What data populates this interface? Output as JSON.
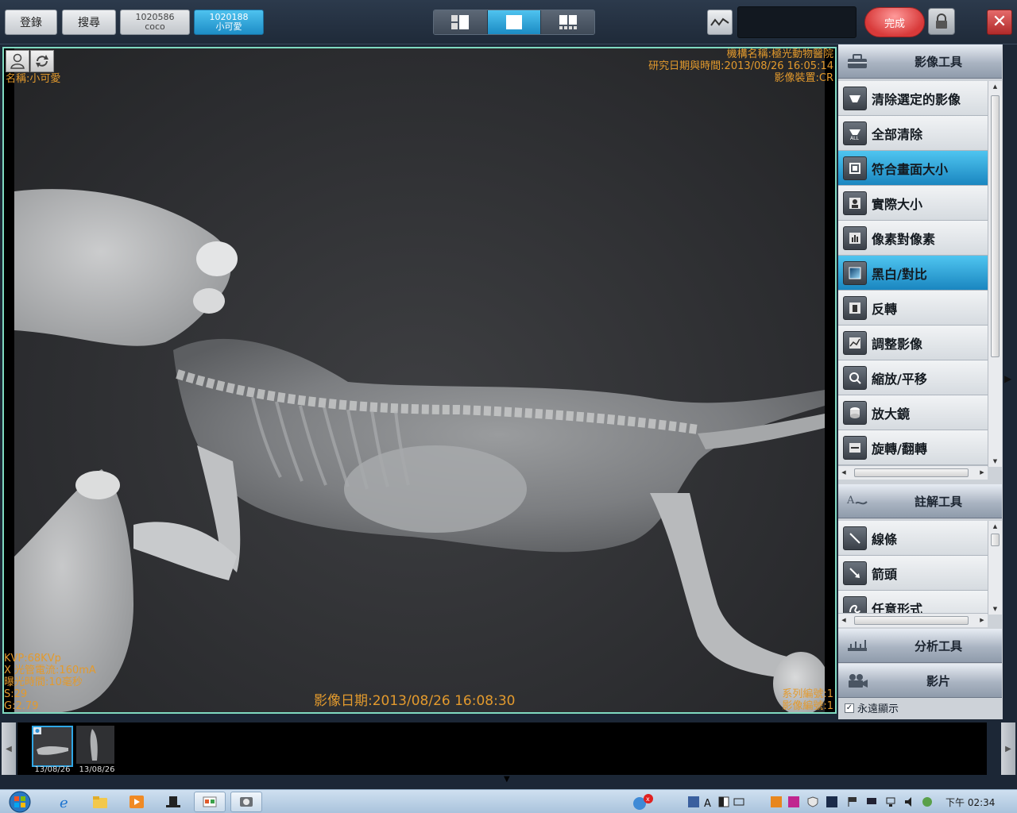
{
  "toolbar": {
    "register_label": "登錄",
    "search_label": "搜尋",
    "patients": [
      {
        "id": "1020586",
        "name": "coco",
        "active": false
      },
      {
        "id": "1020188",
        "name": "小可愛",
        "active": true
      }
    ],
    "done_label": "完成"
  },
  "viewer": {
    "institution": "機構名稱:極光動物醫院",
    "study_datetime": "研究日期與時間:2013/08/26 16:05:14",
    "modality": "影像裝置:CR",
    "patient_name": "名稱:小可愛",
    "kvp": "KVP:68KVp",
    "tube_current": "X 光管電流:160mA",
    "exposure_time": "曝光時間:10毫秒",
    "s_value": "S:29",
    "g_value": "G:2.79",
    "image_date": "影像日期:2013/08/26 16:08:30",
    "series_no": "系列編號:1",
    "image_no": "影像編號:1"
  },
  "panel": {
    "image_tools_title": "影像工具",
    "image_tools": [
      {
        "label": "清除選定的影像",
        "icon": "eraser-icon",
        "active": false
      },
      {
        "label": "全部清除",
        "icon": "clear-all-icon",
        "active": false
      },
      {
        "label": "符合畫面大小",
        "icon": "fit-screen-icon",
        "active": true
      },
      {
        "label": "實際大小",
        "icon": "actual-size-icon",
        "active": false
      },
      {
        "label": "像素對像素",
        "icon": "pixel-icon",
        "active": false
      },
      {
        "label": "黑白/對比",
        "icon": "contrast-icon",
        "active": true
      },
      {
        "label": "反轉",
        "icon": "invert-icon",
        "active": false
      },
      {
        "label": "調整影像",
        "icon": "adjust-image-icon",
        "active": false
      },
      {
        "label": "縮放/平移",
        "icon": "zoom-pan-icon",
        "active": false
      },
      {
        "label": "放大鏡",
        "icon": "magnifier-icon",
        "active": false
      },
      {
        "label": "旋轉/翻轉",
        "icon": "rotate-flip-icon",
        "active": false
      }
    ],
    "annotation_title": "註解工具",
    "annotation_tools": [
      {
        "label": "線條",
        "icon": "line-icon"
      },
      {
        "label": "箭頭",
        "icon": "arrow-icon"
      },
      {
        "label": "任意形式",
        "icon": "freeform-icon"
      }
    ],
    "analysis_title": "分析工具",
    "movie_title": "影片",
    "always_show_label": "永遠顯示",
    "always_show_checked": true
  },
  "thumbnails": [
    {
      "date": "13/08/26",
      "selected": true
    },
    {
      "date": "13/08/26",
      "selected": false
    }
  ],
  "taskbar": {
    "clock": "下午 02:34"
  }
}
